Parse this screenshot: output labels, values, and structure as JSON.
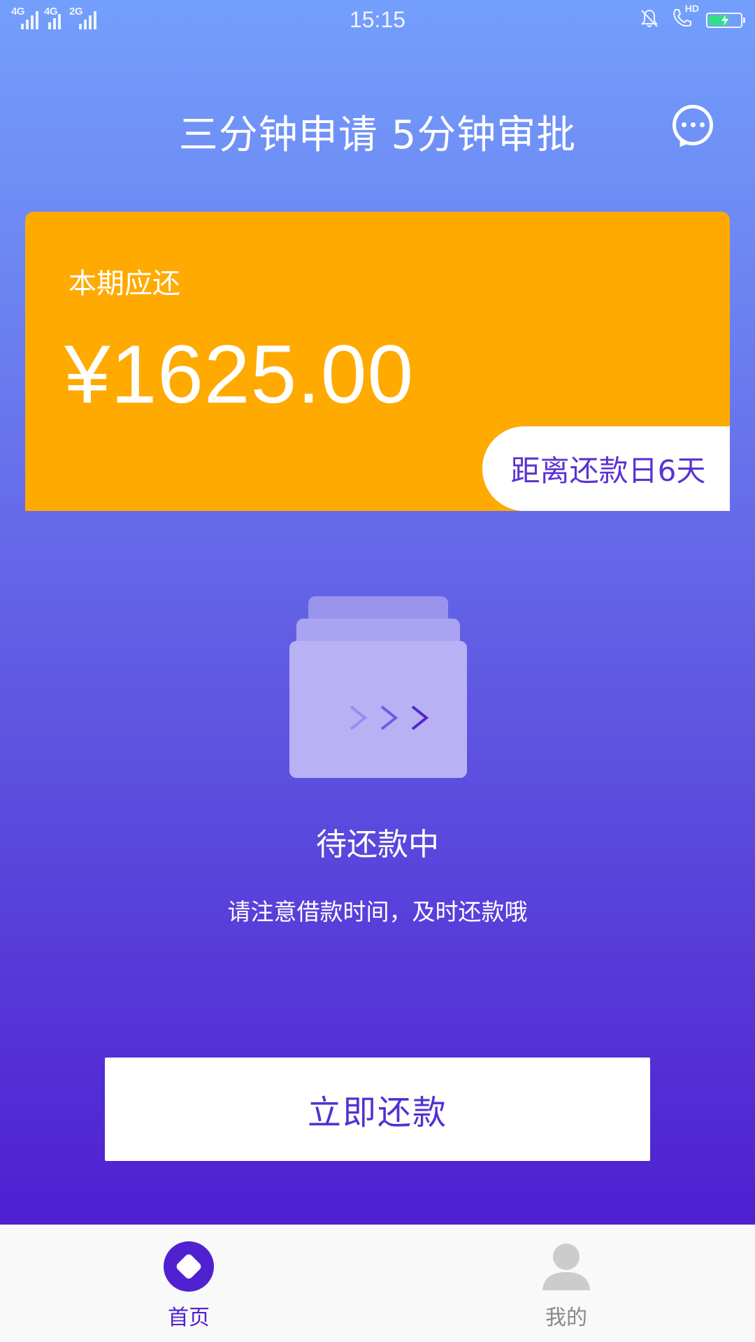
{
  "status_bar": {
    "network_1": "4G",
    "network_2": "4G",
    "network_3": "2G",
    "time": "15:15",
    "call_quality": "HD",
    "battery_color": "#2fe08b"
  },
  "header": {
    "title": "三分钟申请 5分钟审批",
    "chat_icon": "chat-bubble-icon"
  },
  "bill_card": {
    "label": "本期应还",
    "amount": "¥1625.00",
    "due_text": "距离还款日6天",
    "background_color": "#ffaa00"
  },
  "repay_status": {
    "illustration_icon": "folder-arrows-icon",
    "title": "待还款中",
    "description": "请注意借款时间，及时还款哦"
  },
  "actions": {
    "repay_button": "立即还款"
  },
  "tab_bar": {
    "active": "home",
    "items": [
      {
        "id": "home",
        "label": "首页",
        "icon": "home-diamond-icon"
      },
      {
        "id": "mine",
        "label": "我的",
        "icon": "user-icon"
      }
    ]
  },
  "colors": {
    "accent": "#4f21d1",
    "gradient_top": "#739ffc",
    "gradient_bottom": "#4a14cc"
  }
}
